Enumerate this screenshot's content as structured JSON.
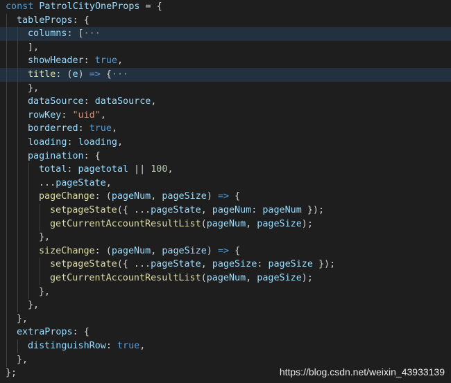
{
  "lines": [
    {
      "indent": 0,
      "hl": false,
      "tokens": [
        {
          "t": "const ",
          "c": "kw"
        },
        {
          "t": "PatrolCityOneProps",
          "c": "var"
        },
        {
          "t": " = {",
          "c": "pl"
        }
      ]
    },
    {
      "indent": 1,
      "hl": false,
      "tokens": [
        {
          "t": "tableProps",
          "c": "var"
        },
        {
          "t": ": {",
          "c": "pl"
        }
      ]
    },
    {
      "indent": 2,
      "hl": true,
      "tokens": [
        {
          "t": "columns",
          "c": "var"
        },
        {
          "t": ": [",
          "c": "pl"
        },
        {
          "t": "···",
          "c": "fold"
        }
      ]
    },
    {
      "indent": 2,
      "hl": false,
      "tokens": [
        {
          "t": "],",
          "c": "pl"
        }
      ]
    },
    {
      "indent": 2,
      "hl": false,
      "tokens": [
        {
          "t": "showHeader",
          "c": "var"
        },
        {
          "t": ": ",
          "c": "pl"
        },
        {
          "t": "true",
          "c": "kw"
        },
        {
          "t": ",",
          "c": "pl"
        }
      ]
    },
    {
      "indent": 2,
      "hl": true,
      "tokens": [
        {
          "t": "title",
          "c": "fn"
        },
        {
          "t": ": (",
          "c": "pl"
        },
        {
          "t": "e",
          "c": "var"
        },
        {
          "t": ") ",
          "c": "pl"
        },
        {
          "t": "=>",
          "c": "kw"
        },
        {
          "t": " {",
          "c": "pl"
        },
        {
          "t": "···",
          "c": "fold"
        }
      ]
    },
    {
      "indent": 2,
      "hl": false,
      "tokens": [
        {
          "t": "},",
          "c": "pl"
        }
      ]
    },
    {
      "indent": 2,
      "hl": false,
      "tokens": [
        {
          "t": "dataSource",
          "c": "var"
        },
        {
          "t": ": ",
          "c": "pl"
        },
        {
          "t": "dataSource",
          "c": "var"
        },
        {
          "t": ",",
          "c": "pl"
        }
      ]
    },
    {
      "indent": 2,
      "hl": false,
      "tokens": [
        {
          "t": "rowKey",
          "c": "var"
        },
        {
          "t": ": ",
          "c": "pl"
        },
        {
          "t": "\"uid\"",
          "c": "str"
        },
        {
          "t": ",",
          "c": "pl"
        }
      ]
    },
    {
      "indent": 2,
      "hl": false,
      "tokens": [
        {
          "t": "borderred",
          "c": "var"
        },
        {
          "t": ": ",
          "c": "pl"
        },
        {
          "t": "true",
          "c": "kw"
        },
        {
          "t": ",",
          "c": "pl"
        }
      ]
    },
    {
      "indent": 2,
      "hl": false,
      "tokens": [
        {
          "t": "loading",
          "c": "var"
        },
        {
          "t": ": ",
          "c": "pl"
        },
        {
          "t": "loading",
          "c": "var"
        },
        {
          "t": ",",
          "c": "pl"
        }
      ]
    },
    {
      "indent": 2,
      "hl": false,
      "tokens": [
        {
          "t": "pagination",
          "c": "var"
        },
        {
          "t": ": {",
          "c": "pl"
        }
      ]
    },
    {
      "indent": 3,
      "hl": false,
      "tokens": [
        {
          "t": "total",
          "c": "var"
        },
        {
          "t": ": ",
          "c": "pl"
        },
        {
          "t": "pagetotal",
          "c": "var"
        },
        {
          "t": " || ",
          "c": "pl"
        },
        {
          "t": "100",
          "c": "num"
        },
        {
          "t": ",",
          "c": "pl"
        }
      ]
    },
    {
      "indent": 3,
      "hl": false,
      "tokens": [
        {
          "t": "...",
          "c": "pl"
        },
        {
          "t": "pageState",
          "c": "var"
        },
        {
          "t": ",",
          "c": "pl"
        }
      ]
    },
    {
      "indent": 3,
      "hl": false,
      "tokens": [
        {
          "t": "pageChange",
          "c": "fn"
        },
        {
          "t": ": (",
          "c": "pl"
        },
        {
          "t": "pageNum",
          "c": "var"
        },
        {
          "t": ", ",
          "c": "pl"
        },
        {
          "t": "pageSize",
          "c": "var"
        },
        {
          "t": ") ",
          "c": "pl"
        },
        {
          "t": "=>",
          "c": "kw"
        },
        {
          "t": " {",
          "c": "pl"
        }
      ]
    },
    {
      "indent": 4,
      "hl": false,
      "tokens": [
        {
          "t": "setpageState",
          "c": "fn"
        },
        {
          "t": "({ ...",
          "c": "pl"
        },
        {
          "t": "pageState",
          "c": "var"
        },
        {
          "t": ", ",
          "c": "pl"
        },
        {
          "t": "pageNum",
          "c": "var"
        },
        {
          "t": ": ",
          "c": "pl"
        },
        {
          "t": "pageNum",
          "c": "var"
        },
        {
          "t": " });",
          "c": "pl"
        }
      ]
    },
    {
      "indent": 4,
      "hl": false,
      "tokens": [
        {
          "t": "getCurrentAccountResultList",
          "c": "fn"
        },
        {
          "t": "(",
          "c": "pl"
        },
        {
          "t": "pageNum",
          "c": "var"
        },
        {
          "t": ", ",
          "c": "pl"
        },
        {
          "t": "pageSize",
          "c": "var"
        },
        {
          "t": ");",
          "c": "pl"
        }
      ]
    },
    {
      "indent": 3,
      "hl": false,
      "tokens": [
        {
          "t": "},",
          "c": "pl"
        }
      ]
    },
    {
      "indent": 3,
      "hl": false,
      "tokens": [
        {
          "t": "sizeChange",
          "c": "fn"
        },
        {
          "t": ": (",
          "c": "pl"
        },
        {
          "t": "pageNum",
          "c": "var"
        },
        {
          "t": ", ",
          "c": "pl"
        },
        {
          "t": "pageSize",
          "c": "var"
        },
        {
          "t": ") ",
          "c": "pl"
        },
        {
          "t": "=>",
          "c": "kw"
        },
        {
          "t": " {",
          "c": "pl"
        }
      ]
    },
    {
      "indent": 4,
      "hl": false,
      "tokens": [
        {
          "t": "setpageState",
          "c": "fn"
        },
        {
          "t": "({ ...",
          "c": "pl"
        },
        {
          "t": "pageState",
          "c": "var"
        },
        {
          "t": ", ",
          "c": "pl"
        },
        {
          "t": "pageSize",
          "c": "var"
        },
        {
          "t": ": ",
          "c": "pl"
        },
        {
          "t": "pageSize",
          "c": "var"
        },
        {
          "t": " });",
          "c": "pl"
        }
      ]
    },
    {
      "indent": 4,
      "hl": false,
      "tokens": [
        {
          "t": "getCurrentAccountResultList",
          "c": "fn"
        },
        {
          "t": "(",
          "c": "pl"
        },
        {
          "t": "pageNum",
          "c": "var"
        },
        {
          "t": ", ",
          "c": "pl"
        },
        {
          "t": "pageSize",
          "c": "var"
        },
        {
          "t": ");",
          "c": "pl"
        }
      ]
    },
    {
      "indent": 3,
      "hl": false,
      "tokens": [
        {
          "t": "},",
          "c": "pl"
        }
      ]
    },
    {
      "indent": 2,
      "hl": false,
      "tokens": [
        {
          "t": "},",
          "c": "pl"
        }
      ]
    },
    {
      "indent": 1,
      "hl": false,
      "tokens": [
        {
          "t": "},",
          "c": "pl"
        }
      ]
    },
    {
      "indent": 1,
      "hl": false,
      "tokens": [
        {
          "t": "extraProps",
          "c": "var"
        },
        {
          "t": ": {",
          "c": "pl"
        }
      ]
    },
    {
      "indent": 2,
      "hl": false,
      "tokens": [
        {
          "t": "distinguishRow",
          "c": "var"
        },
        {
          "t": ": ",
          "c": "pl"
        },
        {
          "t": "true",
          "c": "kw"
        },
        {
          "t": ",",
          "c": "pl"
        }
      ]
    },
    {
      "indent": 1,
      "hl": false,
      "tokens": [
        {
          "t": "},",
          "c": "pl"
        }
      ]
    },
    {
      "indent": 0,
      "hl": false,
      "tokens": [
        {
          "t": "};",
          "c": "pl"
        }
      ]
    }
  ],
  "watermark": "https://blog.csdn.net/weixin_43933139"
}
